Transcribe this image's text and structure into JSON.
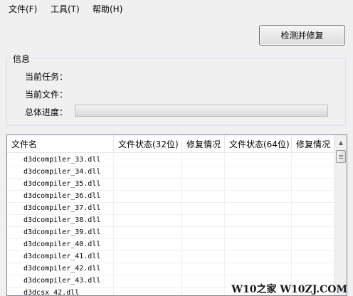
{
  "menu": {
    "file": "文件(F)",
    "tools": "工具(T)",
    "help": "帮助(H)"
  },
  "repair_button": "检测并修复",
  "info": {
    "legend": "信息",
    "current_task_label": "当前任务：",
    "current_file_label": "当前文件：",
    "overall_progress_label": "总体进度：",
    "progress": 0
  },
  "table": {
    "columns": [
      "文件名",
      "文件状态(32位)",
      "修复情况",
      "文件状态(64位)",
      "修复情况"
    ],
    "rows": [
      [
        "d3dcompiler_33.dll",
        "",
        "",
        "",
        ""
      ],
      [
        "d3dcompiler_34.dll",
        "",
        "",
        "",
        ""
      ],
      [
        "d3dcompiler_35.dll",
        "",
        "",
        "",
        ""
      ],
      [
        "d3dcompiler_36.dll",
        "",
        "",
        "",
        ""
      ],
      [
        "d3dcompiler_37.dll",
        "",
        "",
        "",
        ""
      ],
      [
        "d3dcompiler_38.dll",
        "",
        "",
        "",
        ""
      ],
      [
        "d3dcompiler_39.dll",
        "",
        "",
        "",
        ""
      ],
      [
        "d3dcompiler_40.dll",
        "",
        "",
        "",
        ""
      ],
      [
        "d3dcompiler_41.dll",
        "",
        "",
        "",
        ""
      ],
      [
        "d3dcompiler_42.dll",
        "",
        "",
        "",
        ""
      ],
      [
        "d3dcompiler_43.dll",
        "",
        "",
        "",
        ""
      ],
      [
        "d3dcsx_42.dll",
        "",
        "",
        "",
        ""
      ]
    ]
  },
  "watermark": "W10之家 W10ZJ.COM"
}
